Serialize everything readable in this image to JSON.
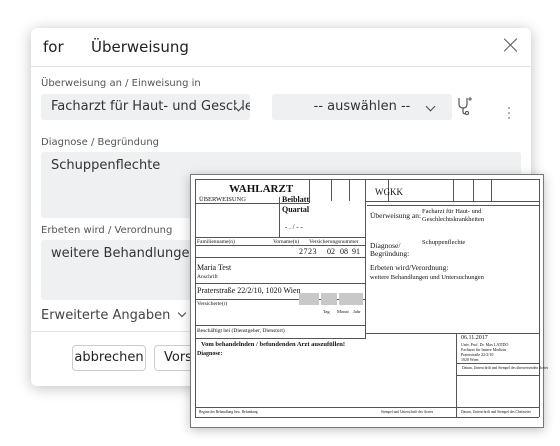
{
  "dialog": {
    "for_label": "for",
    "title": "Überweisung",
    "referral_label": "Überweisung an / Einweisung in",
    "specialist_value": "Facharzt für Haut- und Geschlecht",
    "select_placeholder": "-- auswählen --",
    "diagnosis_label": "Diagnose / Begründung",
    "diagnosis_value": "Schuppenflechte",
    "further_label": "Erbeten wird / Verordnung",
    "further_value": "weitere Behandlungen und U",
    "advanced_label": "Erweiterte Angaben",
    "cancel_label": "abbrechen",
    "preview_label": "Vorsc"
  },
  "form": {
    "header_title": "WAHLARZT",
    "beiblatt": "Beiblatt",
    "quartal": "Quartal",
    "quartal_value": "- . / - -",
    "ueberweisung": "ÜBERWEISUNG",
    "wgkk": "WGKK",
    "familienname": "Familienname(n)",
    "vorname": "Vorname(n)",
    "versicherung": "Versicherungsnummer",
    "vnr": "2723",
    "dob_d": "02",
    "dob_m": "08",
    "dob_y": "91",
    "tag": "Tag",
    "monat": "Monat",
    "jahr": "Jahr",
    "patient_name": "Maria Test",
    "anschrift": "Anschrift",
    "address": "Praterstraße 22/2/10, 1020 Wien",
    "versicherte": "Versicherte(r)",
    "beschaeftigt": "Beschäftigt bei (Dienstgeber, Dienstort)",
    "vom_behandelnden": "Vom behandelnden / befundenden Arzt auszufüllen!",
    "diagnose_lbl": "Diagnose:",
    "ueberweisung_an_lbl": "Überweisung an:",
    "ueberweisung_an_val1": "Facharzt für Haut- und",
    "ueberweisung_an_val2": "Geschlechtskrankheiten",
    "diagnose_begr_lbl1": "Diagnose/",
    "diagnose_begr_lbl2": "Begründung:",
    "diagnose_begr_val": "Schuppenflechte",
    "erbeten_lbl": "Erbeten wird/Verordnung:",
    "erbeten_val": "weitere Behandlungen und Untersuchungen",
    "date": "06.11.2017",
    "doc_line1": "Univ. Prof. Dr. Max LATIDO",
    "doc_line2": "Facharzt für Innere Medizin",
    "doc_line3": "Praterstraße 22/2/10",
    "doc_line4": "1020 Wien",
    "stempel": "Stempel und Unterschrift des Arztes",
    "unterschrift_patient": "Datum, Unterschrift und Stempel des Chefarztes",
    "beginn": "Beginn der Behandlung bzw. Befundung",
    "datum_unterschrift": "Datum, Unterschrift und Stempel des überweisenden Arztes"
  }
}
